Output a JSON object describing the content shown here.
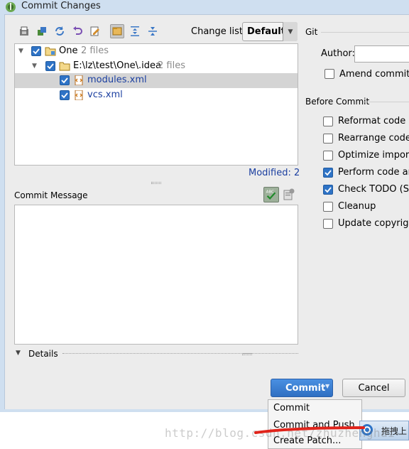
{
  "window": {
    "title": "Commit Changes"
  },
  "toolbar": {
    "icons": [
      "show-diff-icon",
      "refresh-icon",
      "rollback-icon",
      "edit-source-icon",
      "group-by-directory-icon",
      "expand-all-icon",
      "collapse-all-icon",
      "move-to-changelist-icon"
    ],
    "changelist_label": "Change list:",
    "changelist_value": "Default"
  },
  "tree": {
    "rows": [
      {
        "label": "One",
        "count": "2 files"
      },
      {
        "label": "E:\\lz\\test\\One\\.idea",
        "count": "2 files"
      },
      {
        "label": "modules.xml",
        "count": ""
      },
      {
        "label": "vcs.xml",
        "count": ""
      }
    ],
    "modified": "Modified: 2"
  },
  "commit_message": {
    "label": "Commit Message",
    "value": ""
  },
  "details": {
    "label": "Details"
  },
  "git": {
    "section_label": "Git",
    "author_label": "Author:",
    "author_value": "",
    "amend_label": "Amend commit"
  },
  "before_commit": {
    "section_label": "Before Commit",
    "options": [
      {
        "label": "Reformat code",
        "checked": false
      },
      {
        "label": "Rearrange code",
        "checked": false
      },
      {
        "label": "Optimize imports",
        "checked": false
      },
      {
        "label": "Perform code ana",
        "checked": true
      },
      {
        "label": "Check TODO (Sho",
        "checked": true
      },
      {
        "label": "Cleanup",
        "checked": false
      },
      {
        "label": "Update copyright",
        "checked": false
      }
    ]
  },
  "buttons": {
    "commit": "Commit",
    "cancel": "Cancel"
  },
  "popup_menu": {
    "items": [
      "Commit",
      "Commit and Push...",
      "Create Patch..."
    ]
  },
  "tray": {
    "text": "拖拽上"
  },
  "watermark": "http://blog.csdn.net/zhuzhenghai"
}
